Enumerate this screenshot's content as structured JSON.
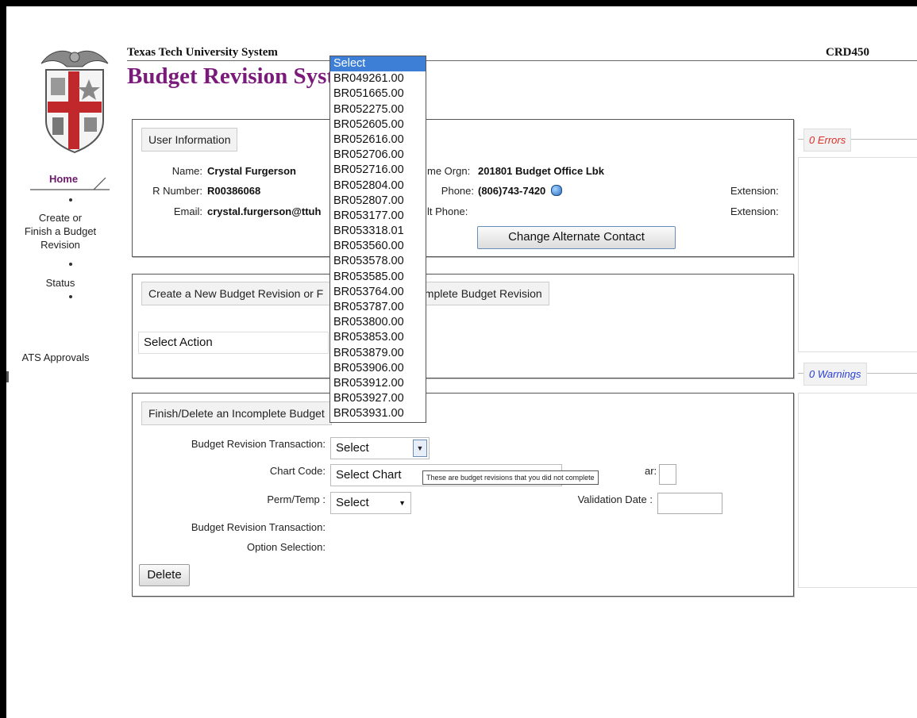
{
  "header": {
    "org": "Texas Tech University System",
    "app_title": "Budget Revision Syst",
    "code": "CRD450"
  },
  "nav": {
    "home": "Home",
    "create_line1": "Create or",
    "create_line2": "Finish a Budget",
    "create_line3": "Revision",
    "status": "Status",
    "ats": "ATS Approvals"
  },
  "user_info": {
    "legend": "User Information",
    "name_label": "Name:",
    "name_value": "Crystal Furgerson",
    "rnum_label": "R Number:",
    "rnum_value": "R00386068",
    "email_label": "Email:",
    "email_value": "crystal.furgerson@ttuh",
    "home_orgn_label": "me Orgn:",
    "home_orgn_value": "201801 Budget Office Lbk",
    "phone_label": "Phone:",
    "phone_value": "(806)743-7420",
    "alt_phone_label": "lt Phone:",
    "ext1_label": "Extension:",
    "ext2_label": "Extension:",
    "change_alt_button": "Change Alternate Contact"
  },
  "create_panel": {
    "legend_left": "Create a New Budget Revision or F",
    "legend_right": "omplete Budget Revision",
    "select_action": "Select Action"
  },
  "finish_panel": {
    "legend": "Finish/Delete an Incomplete Budget",
    "brt_label": "Budget Revision Transaction:",
    "brt_value": "Select",
    "chart_label": "Chart Code:",
    "chart_value": "Select Chart",
    "fiscal_year_label": "ar:",
    "perm_label": "Perm/Temp :",
    "perm_value": "Select",
    "validation_label": "Validation Date :",
    "brt2_label": "Budget Revision Transaction:",
    "option_label": "Option Selection:",
    "delete_button": "Delete"
  },
  "tooltip": "These are budget revisions that you did not complete",
  "side": {
    "errors": "0 Errors",
    "warnings": "0 Warnings",
    "errors_color": "#e0302a",
    "warnings_color": "#2a3fd6"
  },
  "dropdown": {
    "options": [
      "Select",
      "BR049261.00",
      "BR051665.00",
      "BR052275.00",
      "BR052605.00",
      "BR052616.00",
      "BR052706.00",
      "BR052716.00",
      "BR052804.00",
      "BR052807.00",
      "BR053177.00",
      "BR053318.01",
      "BR053560.00",
      "BR053578.00",
      "BR053585.00",
      "BR053764.00",
      "BR053787.00",
      "BR053800.00",
      "BR053853.00",
      "BR053879.00",
      "BR053906.00",
      "BR053912.00",
      "BR053927.00",
      "BR053931.00"
    ],
    "highlight_color": "#3d7fd6"
  }
}
